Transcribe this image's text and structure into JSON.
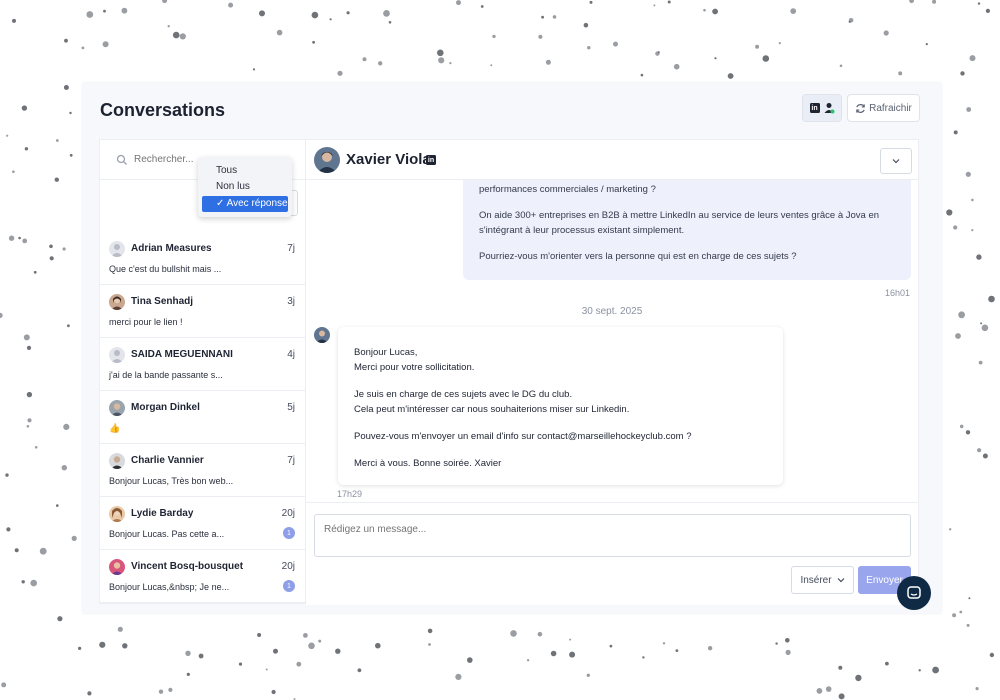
{
  "app": {
    "title": "Conversations"
  },
  "toolbar": {
    "linkedin_badge": "in",
    "refresh_label": "Rafraichir"
  },
  "search": {
    "placeholder": "Rechercher..."
  },
  "filter": {
    "options": [
      "Tous",
      "Non lus",
      "Avec réponse"
    ],
    "selected": "Avec réponse",
    "checkmark": "✓"
  },
  "conversations": [
    {
      "name": "Adrian Measures",
      "time": "7j",
      "preview": "Que c'est du bullshit mais ...",
      "unread": ""
    },
    {
      "name": "Tina Senhadj",
      "time": "3j",
      "preview": "merci pour le lien !",
      "unread": ""
    },
    {
      "name": "SAIDA MEGUENNANI",
      "time": "4j",
      "preview": "j'ai de la bande passante s...",
      "unread": ""
    },
    {
      "name": "Morgan Dinkel",
      "time": "5j",
      "preview": "👍",
      "unread": ""
    },
    {
      "name": "Charlie Vannier",
      "time": "7j",
      "preview": "Bonjour Lucas, Très bon web...",
      "unread": ""
    },
    {
      "name": "Lydie Barday",
      "time": "20j",
      "preview": "Bonjour Lucas. Pas cette a...",
      "unread": "1"
    },
    {
      "name": "Vincent Bosq-bousquet",
      "time": "20j",
      "preview": "Bonjour Lucas,&nbsp; Je ne...",
      "unread": "1"
    }
  ],
  "chat": {
    "contact_name": "Xavier Viola",
    "linkedin_badge": "in",
    "outgoing": {
      "paragraphs": [
        "performances commerciales / marketing ?",
        "On aide 300+ entreprises en B2B à mettre LinkedIn au service de leurs ventes grâce à Jova en s'intégrant à leur processus existant simplement.",
        "Pourriez-vous m'orienter vers la personne qui est en charge de ces sujets ?"
      ],
      "time": "16h01"
    },
    "date_separator": "30 sept. 2025",
    "incoming": {
      "paragraphs": [
        "Bonjour Lucas,\nMerci pour votre sollicitation.",
        "Je suis en charge de ces sujets avec le DG du club.\nCela peut m'intéresser car nous souhaiterions miser sur Linkedin.",
        "Pouvez-vous m'envoyer un email d'info sur contact@marseillehockeyclub.com ?",
        "Merci à vous. Bonne soirée. Xavier"
      ],
      "time": "17h29"
    }
  },
  "composer": {
    "placeholder": "Rédigez un message...",
    "insert_label": "Insérer",
    "send_label": "Envoyer"
  },
  "colors": {
    "accent": "#99a6ee",
    "selected_option": "#2f6fe4",
    "outgoing_bubble": "#eef0fc",
    "help_button": "#0f2a44"
  }
}
